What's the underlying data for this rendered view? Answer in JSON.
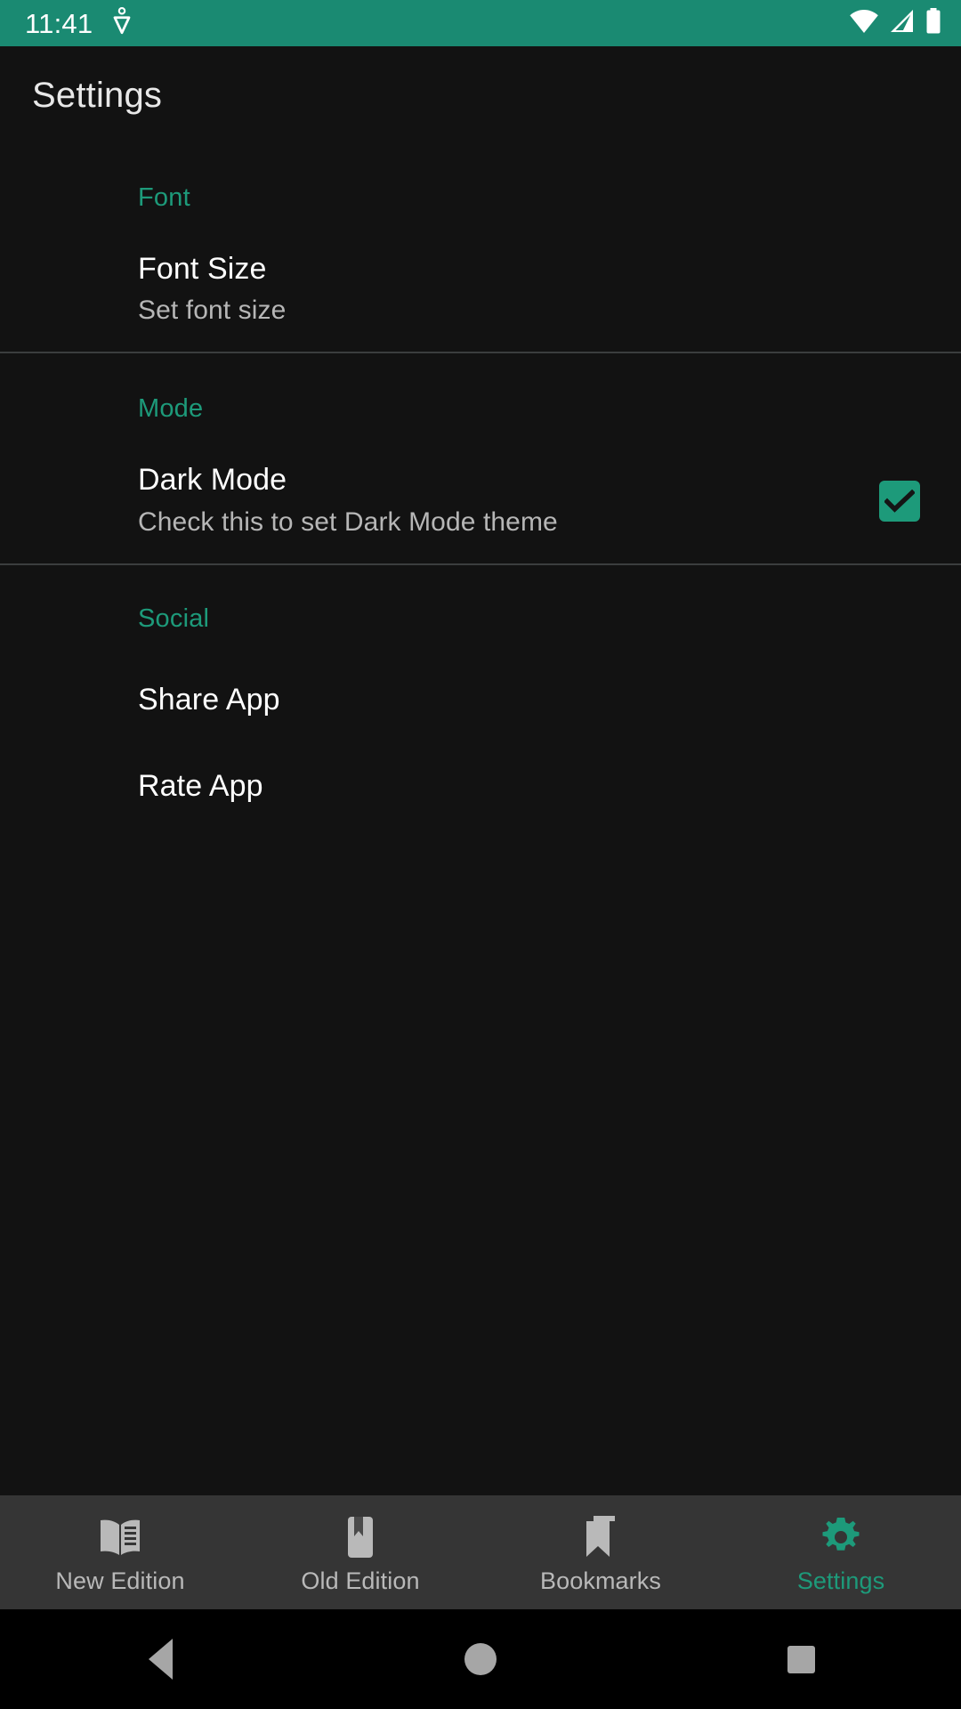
{
  "statusbar": {
    "time": "11:41",
    "left_icons": [
      "location-pin-icon"
    ],
    "right_icons": [
      "wifi-icon",
      "cellular-signal-icon",
      "battery-icon"
    ],
    "background_color": "#1a8a72"
  },
  "appbar": {
    "title": "Settings"
  },
  "theme": {
    "accent_color": "#1d9a7a",
    "background_color": "#121212",
    "nav_background_color": "#353535",
    "title_text_color": "#ffffff",
    "summary_text_color": "#b6b6b6",
    "divider_color": "#3b3d3e"
  },
  "preferences": {
    "groups": [
      {
        "category": "Font",
        "rows": [
          {
            "title": "Font Size",
            "summary": "Set font size",
            "widget": "none"
          }
        ]
      },
      {
        "category": "Mode",
        "rows": [
          {
            "title": "Dark Mode",
            "summary": "Check this to set Dark Mode theme",
            "widget": "checkbox",
            "checked": true
          }
        ]
      },
      {
        "category": "Social",
        "rows": [
          {
            "title": "Share App",
            "summary": "",
            "widget": "none"
          },
          {
            "title": "Rate App",
            "summary": "",
            "widget": "none"
          }
        ]
      }
    ]
  },
  "bottom_nav": {
    "items": [
      {
        "label": "New Edition",
        "icon": "open-book-icon",
        "active": false
      },
      {
        "label": "Old Edition",
        "icon": "book-with-bookmark-icon",
        "active": false
      },
      {
        "label": "Bookmarks",
        "icon": "bookmarks-icon",
        "active": false
      },
      {
        "label": "Settings",
        "icon": "gear-icon",
        "active": true
      }
    ]
  },
  "system_nav": {
    "back_label": "Back",
    "home_label": "Home",
    "recents_label": "Recents"
  }
}
